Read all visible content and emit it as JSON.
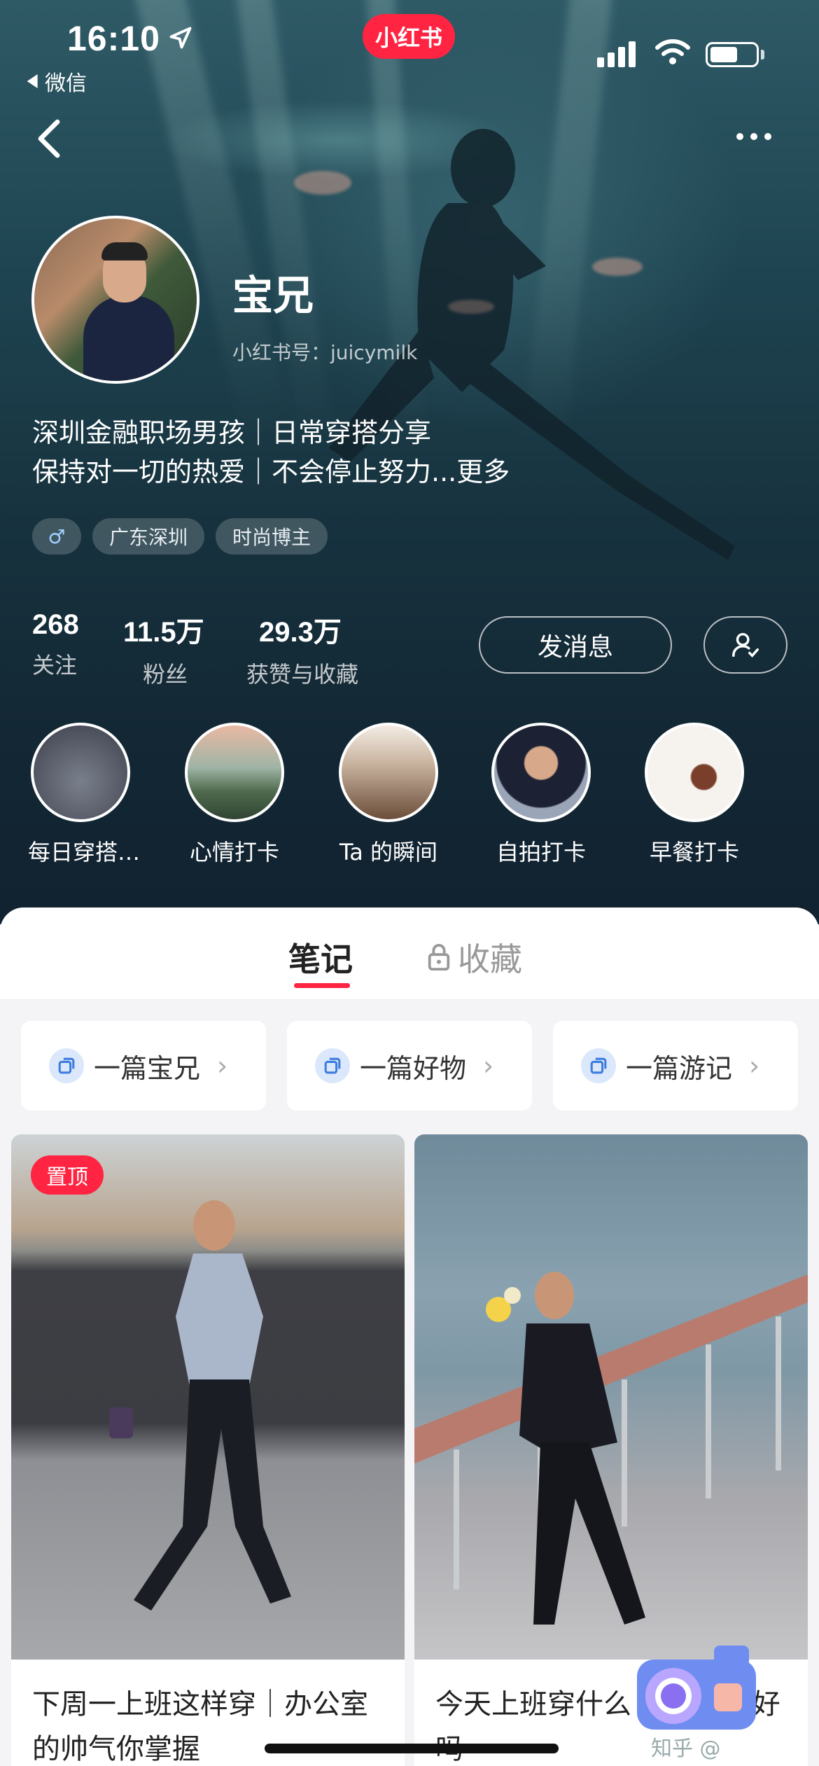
{
  "status_bar": {
    "time": "16:10",
    "back_app": "微信"
  },
  "app_logo": "小红书",
  "profile": {
    "name": "宝兄",
    "red_id": "小红书号：juicymilk",
    "bio_line1": "深圳金融职场男孩｜日常穿搭分享",
    "bio_line2": "保持对一切的热爱｜不会停止努力...更多",
    "tags": {
      "gender": "♂",
      "location": "广东深圳",
      "role": "时尚博主"
    }
  },
  "stats": [
    {
      "value": "268",
      "label": "关注"
    },
    {
      "value": "11.5万",
      "label": "粉丝"
    },
    {
      "value": "29.3万",
      "label": "获赞与收藏"
    }
  ],
  "actions": {
    "message": "发消息"
  },
  "highlights": [
    "每日穿搭…",
    "心情打卡",
    "Ta 的瞬间",
    "自拍打卡",
    "早餐打卡"
  ],
  "tabs": {
    "notes": "笔记",
    "favorites": "收藏"
  },
  "collections": [
    "一篇宝兄",
    "一篇好物",
    "一篇游记"
  ],
  "posts": [
    {
      "pinned_label": "置顶",
      "caption": "下周一上班这样穿｜办公室的帅气你掌握"
    },
    {
      "caption": "今天上班穿什么 单清爽不好吗"
    }
  ],
  "watermark": "知乎 @"
}
